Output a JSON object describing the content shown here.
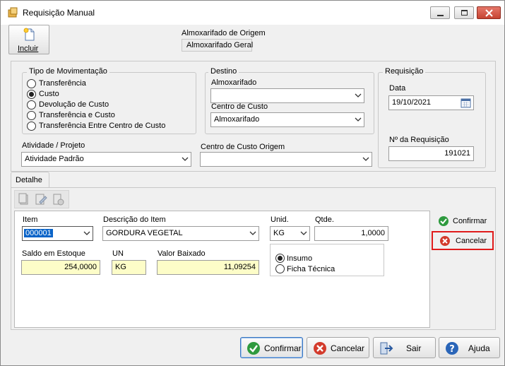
{
  "window": {
    "title": "Requisição Manual"
  },
  "toolbar": {
    "incluir_label": "Incluir"
  },
  "header": {
    "almox_origem_label": "Almoxarifado de Origem",
    "almox_origem_value": "Almoxarifado Geral"
  },
  "movimentacao": {
    "title": "Tipo de Movimentação",
    "options": [
      {
        "label": "Transferência",
        "selected": false
      },
      {
        "label": "Custo",
        "selected": true
      },
      {
        "label": "Devolução de Custo",
        "selected": false
      },
      {
        "label": "Transferência e Custo",
        "selected": false
      },
      {
        "label": "Transferência Entre Centro de Custo",
        "selected": false
      }
    ]
  },
  "destino": {
    "title": "Destino",
    "almox_label": "Almoxarifado",
    "almox_value": "",
    "centro_label": "Centro de Custo",
    "centro_value": "Almoxarifado"
  },
  "requisicao": {
    "title": "Requisição",
    "data_label": "Data",
    "data_value": "19/10/2021",
    "numero_label": "Nº  da Requisição",
    "numero_value": "191021"
  },
  "atividade": {
    "label": "Atividade / Projeto",
    "value": "Atividade Padrão"
  },
  "centro_origem": {
    "label": "Centro de Custo Origem",
    "value": ""
  },
  "tabs": [
    {
      "label": "Detalhe"
    }
  ],
  "detalhe": {
    "item_label": "Item",
    "item_value": "000001",
    "descricao_label": "Descrição do Item",
    "descricao_value": "GORDURA VEGETAL",
    "unid_label": "Unid.",
    "unid_value": "KG",
    "qtde_label": "Qtde.",
    "qtde_value": "1,0000",
    "saldo_label": "Saldo em Estoque",
    "saldo_value": "254,0000",
    "un_label": "UN",
    "un_value": "KG",
    "valor_label": "Valor Baixado",
    "valor_value": "11,09254",
    "tipo_options": [
      {
        "label": "Insumo",
        "selected": true
      },
      {
        "label": "Ficha Técnica",
        "selected": false
      }
    ]
  },
  "side_buttons": {
    "confirmar": "Confirmar",
    "cancelar": "Cancelar"
  },
  "footer_buttons": {
    "confirmar": "Confirmar",
    "cancelar": "Cancelar",
    "sair": "Sair",
    "ajuda": "Ajuda"
  },
  "colors": {
    "confirm_green": "#2e9a3e",
    "cancel_red": "#d33b2c",
    "highlight_red": "#e01b1b",
    "selected_blue": "#0a64c8",
    "readonly_yellow": "#fdfdc8"
  }
}
